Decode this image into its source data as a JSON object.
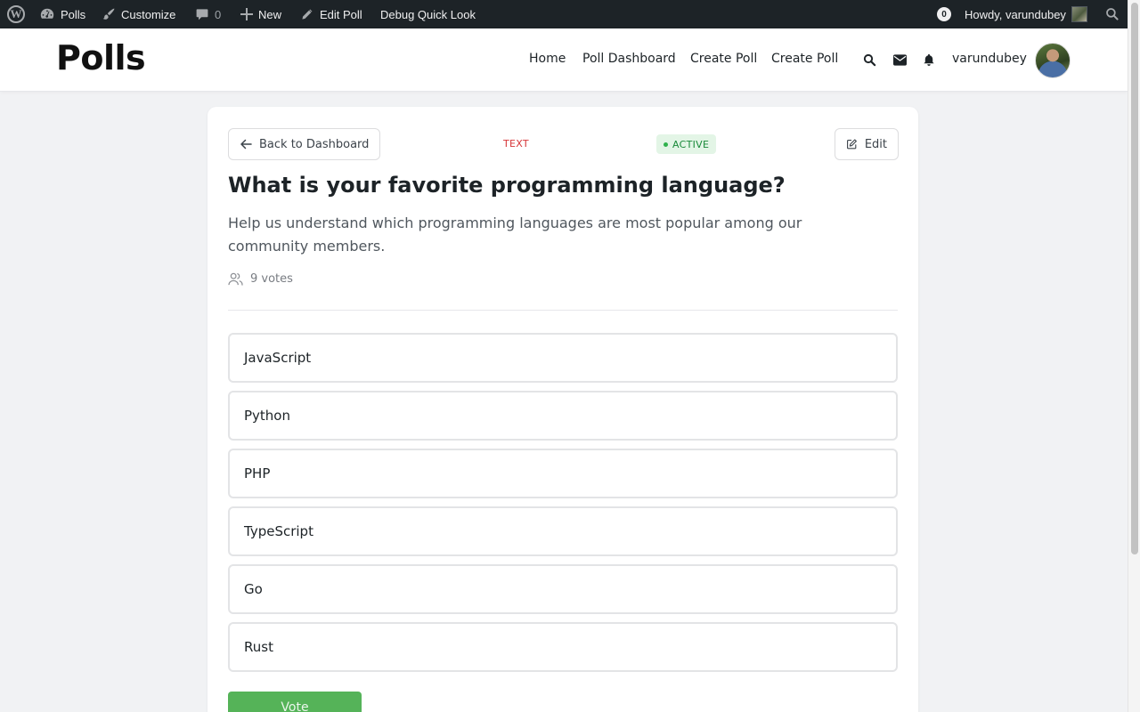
{
  "adminbar": {
    "site_name": "Polls",
    "customize": "Customize",
    "comments_count": "0",
    "new_label": "New",
    "edit_poll": "Edit Poll",
    "debug": "Debug Quick Look",
    "notifications_count": "0",
    "howdy": "Howdy, varundubey"
  },
  "header": {
    "site_title": "Polls",
    "nav": [
      "Home",
      "Poll Dashboard",
      "Create Poll",
      "Create Poll"
    ],
    "username": "varundubey"
  },
  "poll": {
    "back_label": "Back to Dashboard",
    "type": "TEXT",
    "status": "ACTIVE",
    "edit_label": "Edit",
    "title": "What is your favorite programming language?",
    "description": "Help us understand which programming languages are most popular among our community members.",
    "votes": "9 votes",
    "options": [
      "JavaScript",
      "Python",
      "PHP",
      "TypeScript",
      "Go",
      "Rust"
    ],
    "vote_button": "Vote"
  },
  "colors": {
    "adminbar_bg": "#1d2327",
    "accent_green": "#4caf50",
    "status_bg": "#e3f5e6",
    "type_red": "#d63638"
  }
}
